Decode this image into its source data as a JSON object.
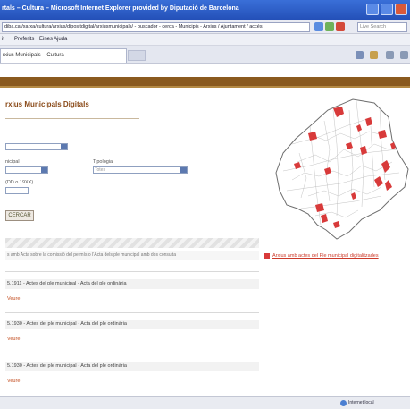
{
  "window": {
    "title": "rtals – Cultura – Microsoft Internet Explorer provided by Diputació de Barcelona"
  },
  "address_bar": {
    "url": "diba.cat/xarxa/cultura/arxius/dipositdigital/arxiusmunicipals/ - buscador - cerca - Municipis - Arxius / Ajuntament / accés",
    "search_placeholder": "Live Search"
  },
  "menu": {
    "items": [
      "it",
      "Preferits",
      "Eines",
      "Ajuda"
    ]
  },
  "tab": {
    "label": "rxius Municipals – Cultura"
  },
  "page": {
    "title": "rxius Municipals Digitals",
    "label_tipologia": "Tipologia",
    "label_municipal": "nicipal",
    "label_dates": "(DD o 19XX)",
    "tipologia_value": "Totes",
    "search_button": "CERCAR",
    "results_info": "s amb Acta sobre la comissió del permís o l’Acta dels ple municipal amb dos consulta",
    "legend_text": "Arxius amb actes del Ple municipal digitalitzades"
  },
  "results": [
    {
      "title": "5.1911 - Actes del ple municipal · Acta del ple ordinària",
      "link": "Veure"
    },
    {
      "title": "5.1930 - Actes del ple municipal · Acta del ple ordinària",
      "link": "Veure"
    },
    {
      "title": "5.1930 - Actes del ple municipal · Acta del ple ordinària",
      "link": "Veure"
    }
  ],
  "status": {
    "zone": "Internet local"
  },
  "colors": {
    "accent": "#8a4a18",
    "banner": "#8a5a1f",
    "link": "#c24a1c",
    "map_highlight": "#d83a3a"
  }
}
